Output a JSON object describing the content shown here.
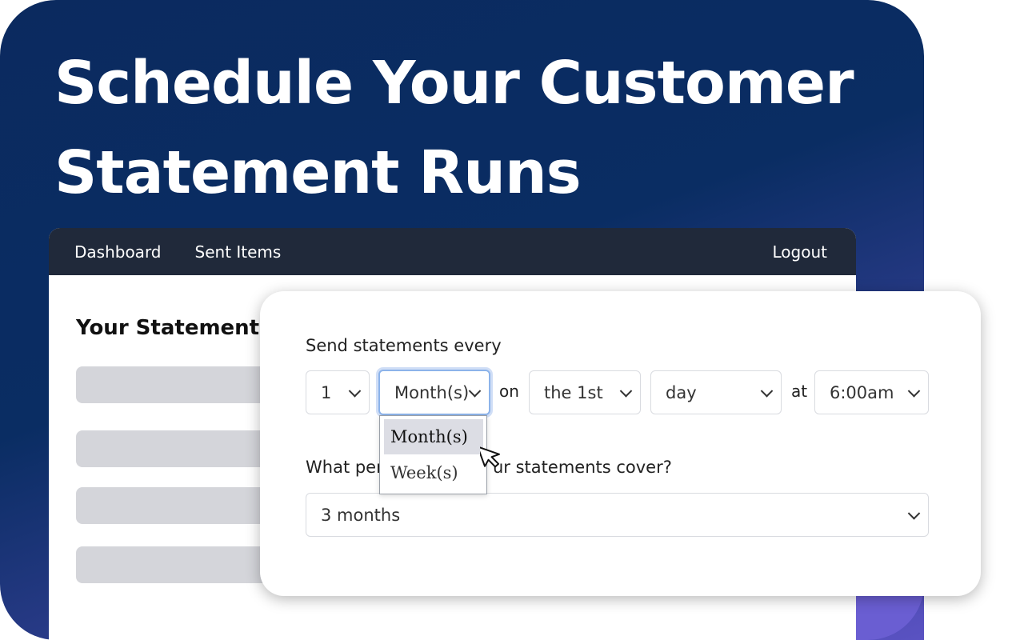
{
  "hero": {
    "title": "Schedule Your Customer Statement Runs"
  },
  "navbar": {
    "links": [
      "Dashboard",
      "Sent Items"
    ],
    "logout": "Logout"
  },
  "page": {
    "section_title": "Your Statement"
  },
  "schedule_form": {
    "frequency_label": "Send statements every",
    "interval": "1",
    "unit": "Month(s)",
    "on_label": "on",
    "ordinal": "the 1st",
    "day_type": "day",
    "at_label": "at",
    "time": "6:00am",
    "unit_options": [
      "Month(s)",
      "Week(s)"
    ],
    "period_label": "What period should your statements cover?",
    "period_label_visible_left": "What per",
    "period_label_visible_right": "ur statements cover?",
    "period": "3 months"
  },
  "colors": {
    "hero_gradient_start": "#0b2a5f",
    "hero_gradient_end": "#5a52c2",
    "navbar": "#20293a",
    "focus_ring": "#8cb3ea",
    "placeholder": "#d4d5da"
  },
  "icons": {
    "cursor": "mouse-pointer-icon",
    "chevron": "chevron-down-icon"
  }
}
